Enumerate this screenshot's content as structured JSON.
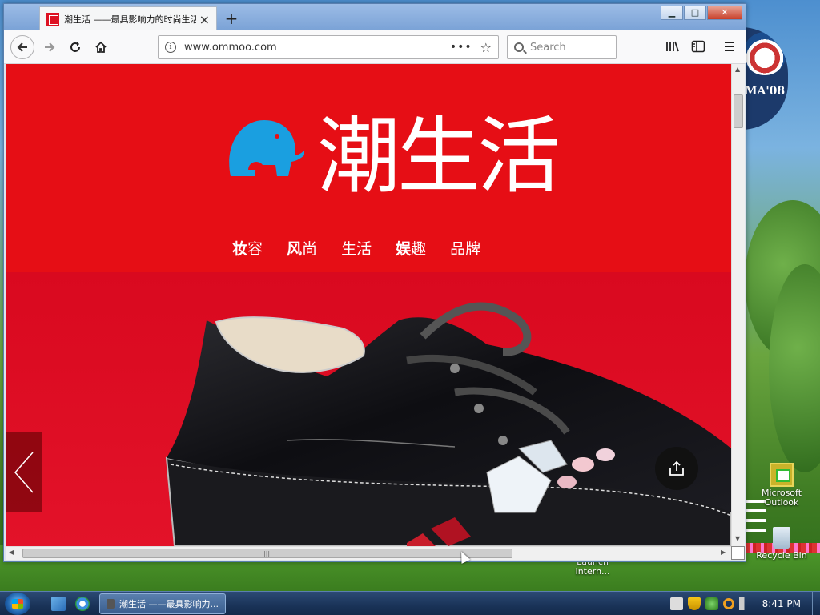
{
  "browser": {
    "tab_title": "潮生活 ——最具影响力的时尚生活",
    "url": "www.ommoo.com",
    "search_placeholder": "Search"
  },
  "site": {
    "brand": "潮生活",
    "nav": [
      {
        "lead": "妆",
        "rest": "容"
      },
      {
        "lead": "风",
        "rest": "尚"
      },
      {
        "lead": "生",
        "rest": "活"
      },
      {
        "lead": "娱",
        "rest": "趣"
      },
      {
        "lead": "品",
        "rest": "牌"
      }
    ]
  },
  "desktop": {
    "icons": [
      {
        "label": "Microsoft Outlook"
      },
      {
        "label": "Recycle Bin"
      },
      {
        "label": "Launch Intern..."
      }
    ],
    "wallpaper_text": "MA'08"
  },
  "taskbar": {
    "task_label": "潮生活 ——最具影响力...",
    "clock": "8:41 PM"
  },
  "colors": {
    "brand_red": "#e60e15",
    "accent_blue": "#1a9fe0"
  }
}
